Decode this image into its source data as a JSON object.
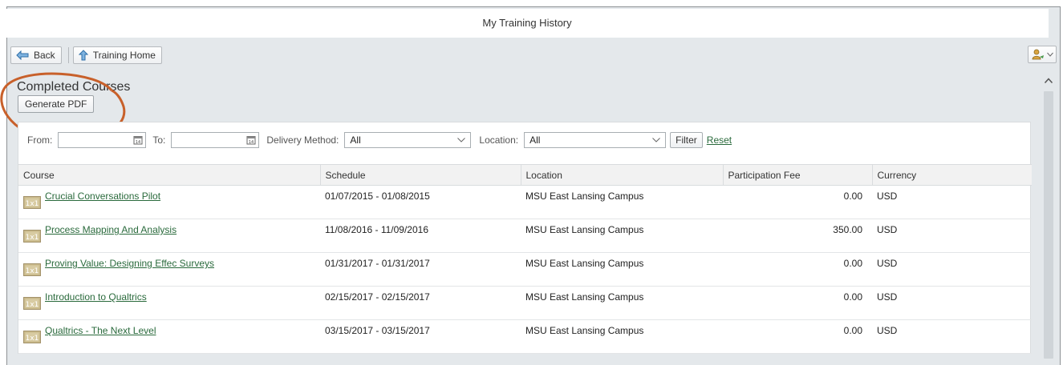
{
  "window": {
    "title": "My Training History"
  },
  "toolbar": {
    "back_label": "Back",
    "home_label": "Training Home"
  },
  "section": {
    "title": "Completed Courses",
    "pdf_label": "Generate PDF"
  },
  "filters": {
    "from_label": "From:",
    "to_label": "To:",
    "delivery_label": "Delivery Method:",
    "delivery_value": "All",
    "location_label": "Location:",
    "location_value": "All",
    "filter_label": "Filter",
    "reset_label": "Reset"
  },
  "table": {
    "headers": [
      "Course",
      "Schedule",
      "Location",
      "Participation Fee",
      "Currency"
    ],
    "rows": [
      {
        "course": "Crucial Conversations Pilot",
        "schedule": "01/07/2015 - 01/08/2015",
        "location": "MSU East Lansing Campus",
        "fee": "0.00",
        "currency": "USD"
      },
      {
        "course": "Process Mapping And Analysis",
        "schedule": "11/08/2016 - 11/09/2016",
        "location": "MSU East Lansing Campus",
        "fee": "350.00",
        "currency": "USD"
      },
      {
        "course": "Proving Value: Designing Effec Surveys",
        "schedule": "01/31/2017 - 01/31/2017",
        "location": "MSU East Lansing Campus",
        "fee": "0.00",
        "currency": "USD"
      },
      {
        "course": "Introduction to Qualtrics",
        "schedule": "02/15/2017 - 02/15/2017",
        "location": "MSU East Lansing Campus",
        "fee": "0.00",
        "currency": "USD"
      },
      {
        "course": "Qualtrics - The Next Level",
        "schedule": "03/15/2017 - 03/15/2017",
        "location": "MSU East Lansing Campus",
        "fee": "0.00",
        "currency": "USD"
      }
    ]
  },
  "icons": {
    "back": "back-arrow-icon",
    "home": "up-arrow-icon",
    "user": "user-settings-icon",
    "calendar": "calendar-icon",
    "course_type": "course-1x1-icon",
    "dropdown": "chevron-down-icon",
    "scroll_up": "chevron-up-icon"
  },
  "colors": {
    "link": "#2a6a3c",
    "annotation": "#c8602a",
    "background": "#e4e8eb"
  }
}
